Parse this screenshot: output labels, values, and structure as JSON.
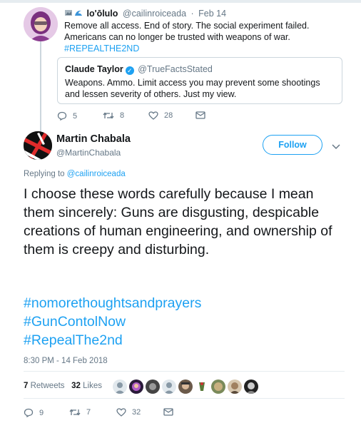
{
  "parent_tweet": {
    "display_name": "lo'ōlulo",
    "handle": "@cailinroiceada",
    "date": "Feb 14",
    "text": "Remove all access. End of story. The social experiment failed. Americans can no longer be trusted with weapons of war.",
    "hashtag": "#REPEALTHE2ND",
    "quoted": {
      "display_name": "Claude Taylor",
      "handle": "@TrueFactsStated",
      "text": "Weapons. Ammo. Limit access you may prevent some shootings and lessen severity of others. Just my view."
    },
    "actions": {
      "replies": "5",
      "retweets": "8",
      "likes": "28"
    }
  },
  "main_tweet": {
    "display_name": "Martin Chabala",
    "handle": "@MartinChabala",
    "follow_label": "Follow",
    "replying_prefix": "Replying to",
    "replying_handle": "@cailinroiceada",
    "text": "I choose these words carefully because I mean them sincerely: Guns are disgusting, despicable creations of human engineering, and ownership of them is creepy and disturbing.",
    "hashtags": [
      "#nomorethoughtsandprayers",
      "#GunContolNow",
      "#RepealThe2nd"
    ],
    "timestamp": "8:30 PM - 14 Feb 2018",
    "retweets_count": "7",
    "retweets_label": "Retweets",
    "likes_count": "32",
    "likes_label": "Likes",
    "actions": {
      "replies": "9",
      "retweets": "7",
      "likes": "32"
    }
  },
  "colors": {
    "accent": "#1da1f2",
    "secondary_text": "#657786",
    "border": "#ccd6dd"
  },
  "icons": [
    "reply-icon",
    "retweet-icon",
    "like-icon",
    "dm-icon",
    "verified-icon",
    "chevron-down-icon"
  ]
}
